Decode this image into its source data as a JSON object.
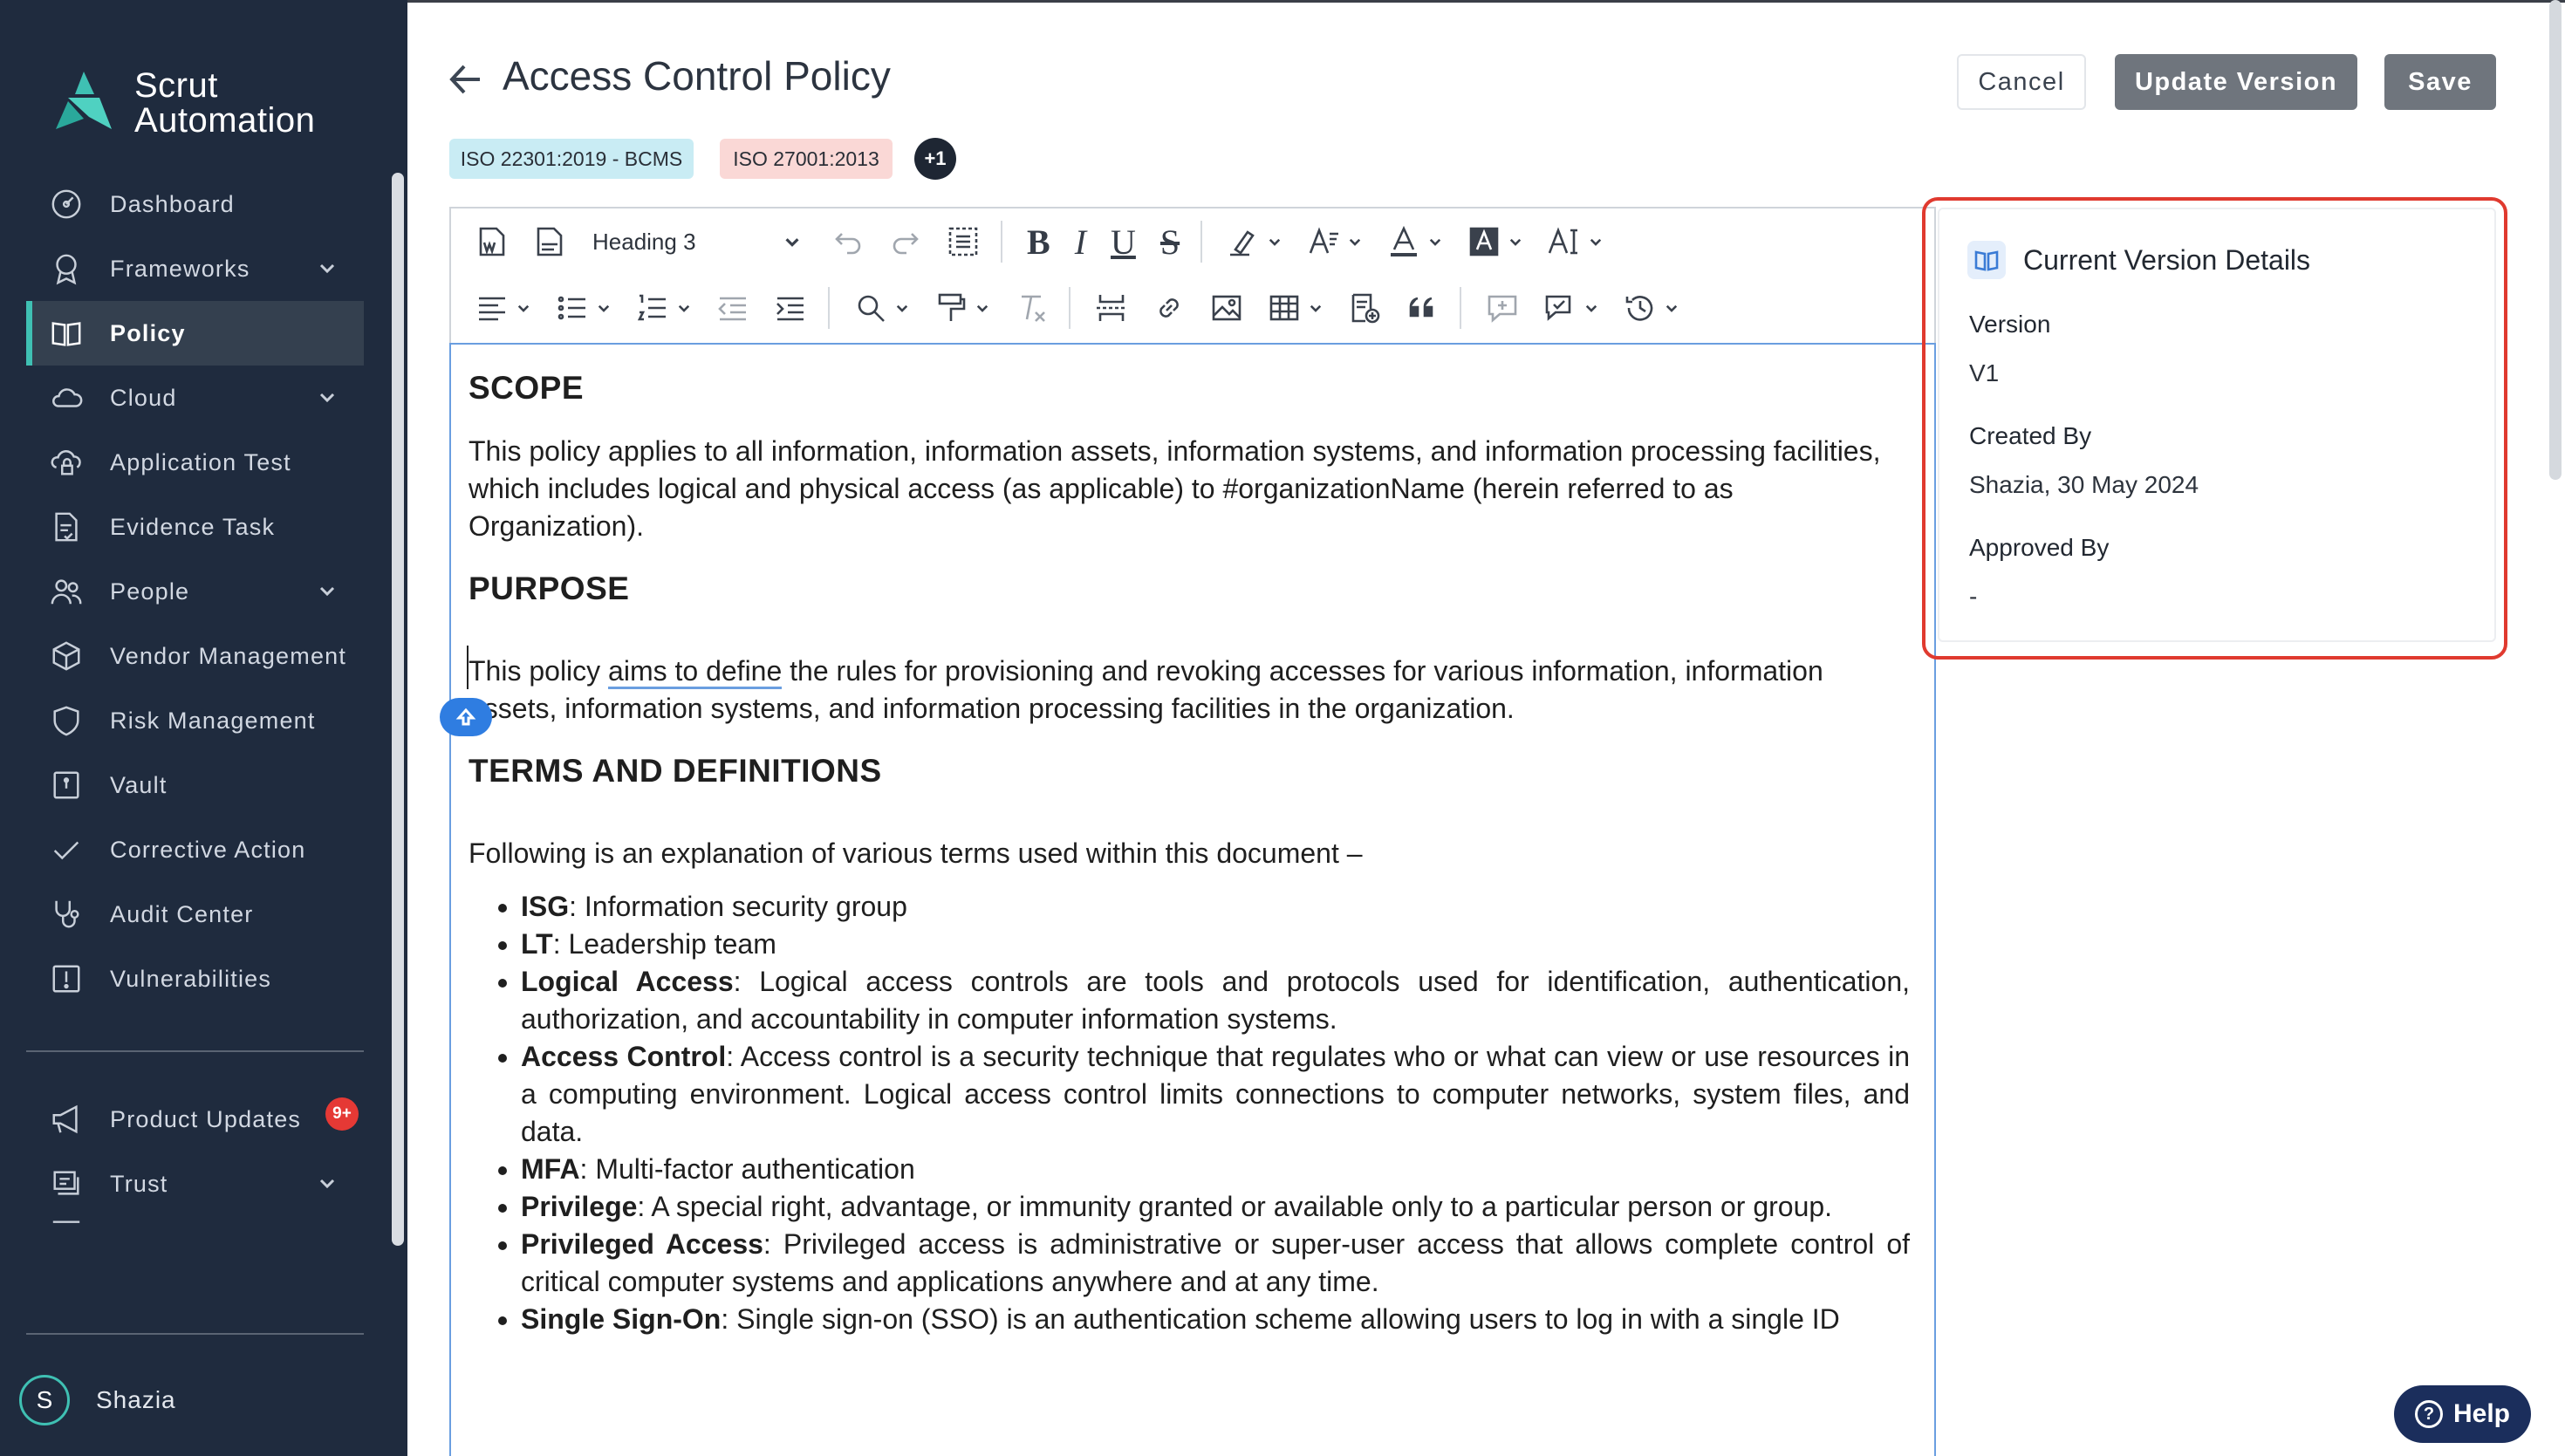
{
  "app": {
    "logo_line1": "Scrut",
    "logo_line2": "Automation",
    "accent": "#3fc0b3"
  },
  "sidebar": {
    "items": [
      {
        "label": "Dashboard",
        "icon": "dashboard-icon"
      },
      {
        "label": "Frameworks",
        "icon": "award-icon",
        "expandable": true
      },
      {
        "label": "Policy",
        "icon": "book-icon",
        "active": true
      },
      {
        "label": "Cloud",
        "icon": "cloud-icon",
        "expandable": true
      },
      {
        "label": "Application Test",
        "icon": "cloud-lock-icon"
      },
      {
        "label": "Evidence Task",
        "icon": "document-check-icon"
      },
      {
        "label": "People",
        "icon": "people-icon",
        "expandable": true
      },
      {
        "label": "Vendor Management",
        "icon": "box-icon"
      },
      {
        "label": "Risk Management",
        "icon": "shield-icon"
      },
      {
        "label": "Vault",
        "icon": "vault-icon"
      },
      {
        "label": "Corrective Action",
        "icon": "check-icon"
      },
      {
        "label": "Audit Center",
        "icon": "stethoscope-icon"
      },
      {
        "label": "Vulnerabilities",
        "icon": "alert-icon"
      }
    ],
    "bottom_items": [
      {
        "label": "Product Updates",
        "icon": "megaphone-icon",
        "badge": "9+"
      },
      {
        "label": "Trust",
        "icon": "trust-icon",
        "expandable": true
      }
    ],
    "user": {
      "initial": "S",
      "name": "Shazia"
    }
  },
  "header": {
    "title": "Access Control Policy",
    "cancel_label": "Cancel",
    "update_label": "Update Version",
    "save_label": "Save",
    "tags": [
      "ISO 22301:2019 - BCMS",
      "ISO 27001:2013",
      "+1"
    ]
  },
  "toolbar": {
    "heading_value": "Heading 3",
    "bold": "B",
    "italic": "I",
    "underline": "U",
    "strike": "S"
  },
  "document": {
    "scope_heading": "SCOPE",
    "scope_text": "This policy applies to all information, information assets, information systems, and information processing facilities, which includes logical and physical access (as applicable) to #organizationName (herein referred to as Organization).",
    "purpose_heading": "PURPOSE",
    "purpose_a": "This policy ",
    "purpose_b": "aims to define",
    "purpose_c": " the rules for provisioning and revoking accesses for various information, information assets, information systems, and information processing facilities in the organization.",
    "terms_heading": "TERMS AND DEFINITIONS",
    "terms_intro": "Following is an explanation of various terms used within this document –",
    "terms": [
      {
        "term": "ISG",
        "def": ": Information security group"
      },
      {
        "term": "LT",
        "def": ": Leadership team"
      },
      {
        "term": "Logical Access",
        "def": ": Logical access controls are tools and protocols used for identification, authentication, authorization, and accountability in computer information systems."
      },
      {
        "term": "Access Control",
        "def": ": Access control is a security technique that regulates who or what can view or use resources in a computing environment. Logical access control limits connections to computer networks, system files, and data."
      },
      {
        "term": "MFA",
        "def": ": Multi-factor authentication"
      },
      {
        "term": "Privilege",
        "def": ": A special right, advantage, or immunity granted or available only to a particular person or group."
      },
      {
        "term": "Privileged Access",
        "def": ": Privileged access is administrative or super-user access that allows complete control of critical computer systems and applications anywhere and at any time."
      },
      {
        "term": "Single Sign-On",
        "def": ": Single sign-on (SSO) is an authentication scheme allowing users to log in with a single ID"
      }
    ]
  },
  "version_panel": {
    "title": "Current Version Details",
    "version_label": "Version",
    "version_value": "V1",
    "created_label": "Created By",
    "created_value": "Shazia, 30 May 2024",
    "approved_label": "Approved By",
    "approved_value": "-"
  },
  "help": {
    "label": "Help"
  }
}
